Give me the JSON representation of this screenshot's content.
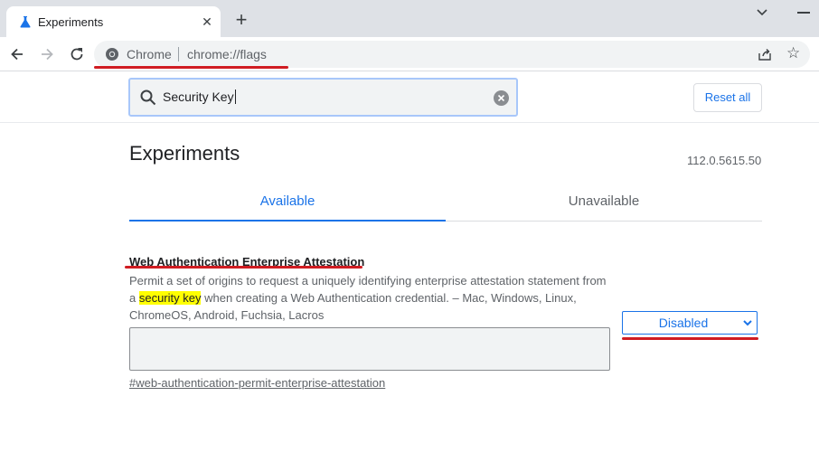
{
  "browser": {
    "tab_title": "Experiments",
    "omnibox_scheme_label": "Chrome",
    "omnibox_url": "chrome://flags"
  },
  "header": {
    "search_value": "Security Key",
    "reset_label": "Reset all"
  },
  "main": {
    "title": "Experiments",
    "version": "112.0.5615.50",
    "tabs": [
      {
        "label": "Available",
        "selected": true
      },
      {
        "label": "Unavailable",
        "selected": false
      }
    ]
  },
  "flag": {
    "name": "Web Authentication Enterprise Attestation",
    "desc_before": "Permit a set of origins to request a uniquely identifying enterprise attestation statement from a ",
    "desc_highlight": "security key",
    "desc_after": " when creating a Web Authentication credential. – Mac, Windows, Linux, ChromeOS, Android, Fuchsia, Lacros",
    "anchor": "#web-authentication-permit-enterprise-attestation",
    "select_value": "Disabled"
  },
  "colors": {
    "accent": "#1a73e8",
    "annotation_red": "#d01c22",
    "highlight": "#ffff00"
  }
}
